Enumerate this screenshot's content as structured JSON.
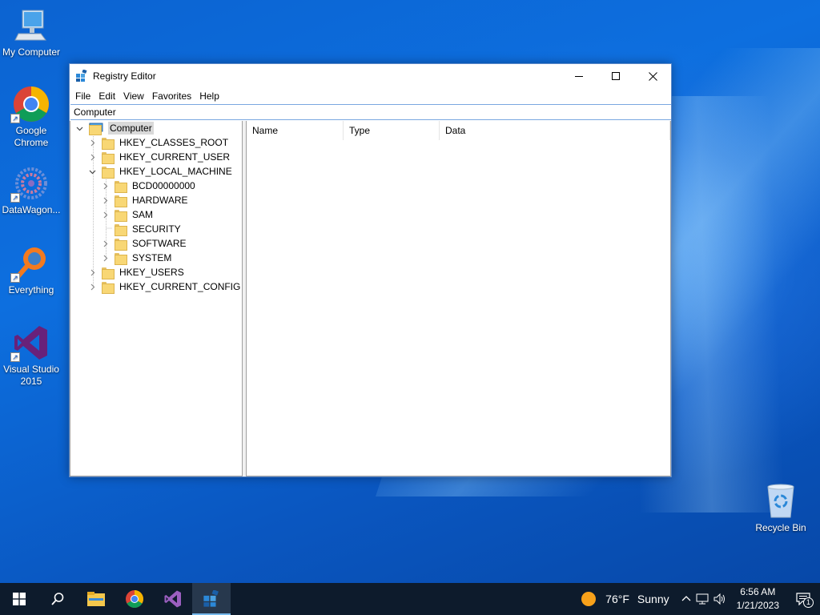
{
  "desktop": {
    "icons": [
      {
        "label": "My Computer",
        "icon": "my-computer-icon"
      },
      {
        "label": "Google Chrome",
        "icon": "chrome-icon"
      },
      {
        "label": "DataWagon...",
        "icon": "datawagon-icon"
      },
      {
        "label": "Everything",
        "icon": "everything-icon"
      },
      {
        "label": "Visual Studio 2015",
        "icon": "visual-studio-icon"
      },
      {
        "label": "Recycle Bin",
        "icon": "recycle-bin-icon"
      }
    ]
  },
  "window": {
    "title": "Registry Editor",
    "menu": [
      "File",
      "Edit",
      "View",
      "Favorites",
      "Help"
    ],
    "address": "Computer",
    "tree": {
      "root": "Computer",
      "hives": [
        "HKEY_CLASSES_ROOT",
        "HKEY_CURRENT_USER",
        "HKEY_LOCAL_MACHINE"
      ],
      "hklm_children": [
        "BCD00000000",
        "HARDWARE",
        "SAM",
        "SECURITY",
        "SOFTWARE",
        "SYSTEM"
      ],
      "hives_after": [
        "HKEY_USERS",
        "HKEY_CURRENT_CONFIG"
      ]
    },
    "columns": [
      "Name",
      "Type",
      "Data"
    ]
  },
  "taskbar": {
    "weather": {
      "temp": "76°F",
      "condition": "Sunny"
    },
    "clock": {
      "time": "6:56 AM",
      "date": "1/21/2023"
    },
    "notification_count": "1"
  },
  "colors": {
    "accent": "#0078d7",
    "taskbar": "#0d1b2c",
    "folder": "#f8d775"
  }
}
